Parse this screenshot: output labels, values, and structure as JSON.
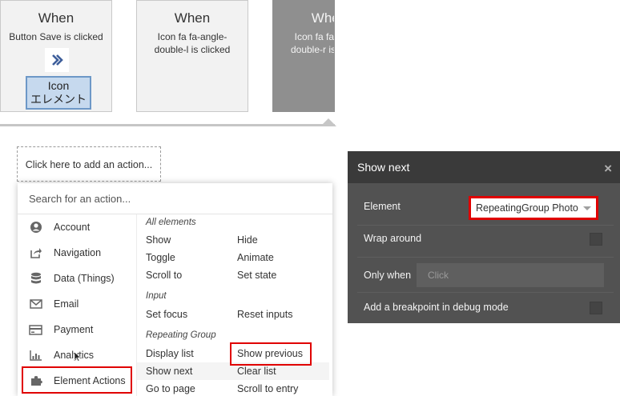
{
  "workflow_cards": [
    {
      "when": "When",
      "desc_lines": [
        "Button Save is clicked"
      ],
      "icon_label_lines": [
        "Icon",
        "エレメント"
      ]
    },
    {
      "when": "When",
      "desc_lines": [
        "Icon fa fa-angle-",
        "double-l is clicked"
      ]
    },
    {
      "when": "When",
      "desc_lines": [
        "Icon fa fa-angle-",
        "double-r is clicked"
      ]
    }
  ],
  "add_action": "Click here to add an action...",
  "action_search": {
    "placeholder": "Search for an action..."
  },
  "categories": [
    {
      "label": "Account",
      "icon": "user-circle-icon"
    },
    {
      "label": "Navigation",
      "icon": "share-arrow-icon"
    },
    {
      "label": "Data (Things)",
      "icon": "database-icon"
    },
    {
      "label": "Email",
      "icon": "envelope-icon"
    },
    {
      "label": "Payment",
      "icon": "credit-card-icon"
    },
    {
      "label": "Analytics",
      "icon": "bar-chart-icon"
    },
    {
      "label": "Element Actions",
      "icon": "puzzle-piece-icon"
    }
  ],
  "sections": [
    {
      "title": "All elements",
      "actions": [
        "Show",
        "Hide",
        "Toggle",
        "Animate",
        "Scroll to",
        "Set state"
      ]
    },
    {
      "title": "Input",
      "actions": [
        "Set focus",
        "Reset inputs"
      ]
    },
    {
      "title": "Repeating Group",
      "actions": [
        "Display list",
        "Show previous",
        "Show next",
        "Clear list",
        "Go to page",
        "Scroll to entry"
      ]
    }
  ],
  "panel": {
    "title": "Show next",
    "close": "×",
    "element_label": "Element",
    "element_value": "RepeatingGroup Photo",
    "wrap_label": "Wrap around",
    "only_when_label": "Only when",
    "only_when_placeholder": "Click",
    "breakpoint_label": "Add a breakpoint in debug mode"
  },
  "colors": {
    "highlight_red": "#e00000",
    "icon_selection": "#c6d9ee",
    "panel_bg": "#525252",
    "panel_header": "#3a3a3a"
  }
}
